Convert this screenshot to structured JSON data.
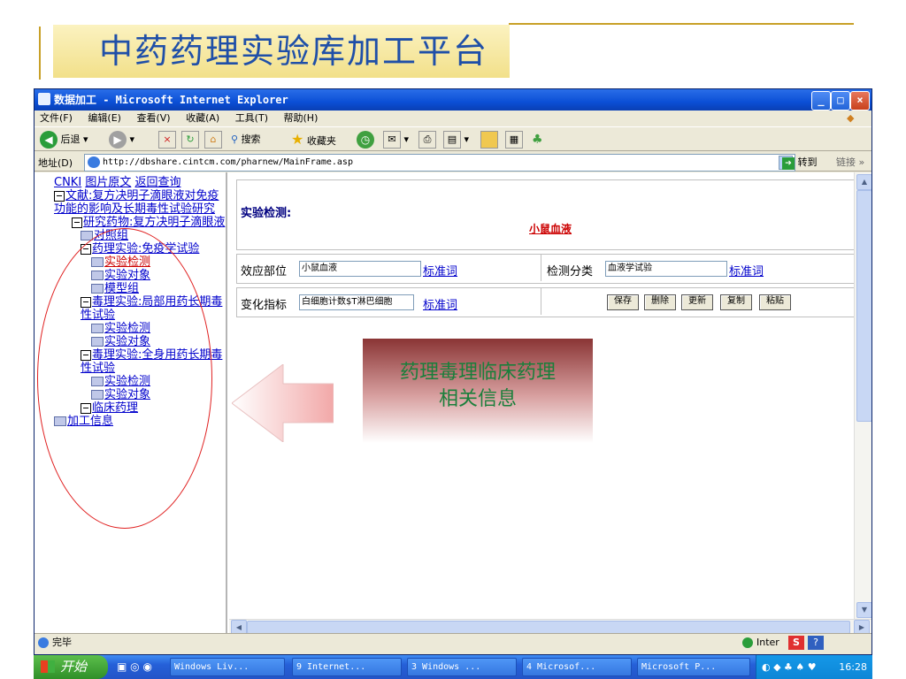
{
  "slide": {
    "title": "中药药理实验库加工平台"
  },
  "window": {
    "title": "数据加工 - Microsoft Internet Explorer",
    "menu": [
      "文件(F)",
      "编辑(E)",
      "查看(V)",
      "收藏(A)",
      "工具(T)",
      "帮助(H)"
    ],
    "toolbar": {
      "back": "后退",
      "search": "搜索",
      "favorites": "收藏夹"
    },
    "address": {
      "label": "地址(D)",
      "url": "http://dbshare.cintcm.com/pharnew/MainFrame.asp",
      "go": "转到",
      "links": "链接 »"
    },
    "status": "完毕",
    "zone": "Inter"
  },
  "tree": {
    "top_links": [
      "CNKI",
      "图片原文",
      "返回查询"
    ],
    "items": [
      "文献:复方决明子滴眼液对免疫功能的影响及长期毒性试验研究",
      "研究药物:复方决明子滴眼液",
      "对照组",
      "药理实验:免疫学试验",
      "实验检测",
      "实验对象",
      "模型组",
      "毒理实验:局部用药长期毒性试验",
      "实验检测",
      "实验对象",
      "毒理实验:全身用药长期毒性试验",
      "实验检测",
      "实验对象",
      "临床药理",
      "加工信息"
    ]
  },
  "form": {
    "section_title": "实验检测:",
    "subject": "小鼠血液",
    "row1": {
      "label_a": "效应部位",
      "value_a": "小鼠血液",
      "link_a": "标准词",
      "label_b": "检测分类",
      "value_b": "血液学试验",
      "link_b": "标准词"
    },
    "row2": {
      "label": "变化指标",
      "value": "白细胞计数$T淋巴细胞",
      "link": "标准词"
    },
    "buttons": [
      "保存",
      "删除",
      "更新",
      "复制",
      "粘贴"
    ]
  },
  "annotation": {
    "line1": "药理毒理临床药理",
    "line2": "相关信息"
  },
  "taskbar": {
    "start": "开始",
    "items": [
      "Windows Liv...",
      "9 Internet...",
      "3 Windows ...",
      "4 Microsof...",
      "Microsoft P..."
    ],
    "clock": "16:28"
  }
}
